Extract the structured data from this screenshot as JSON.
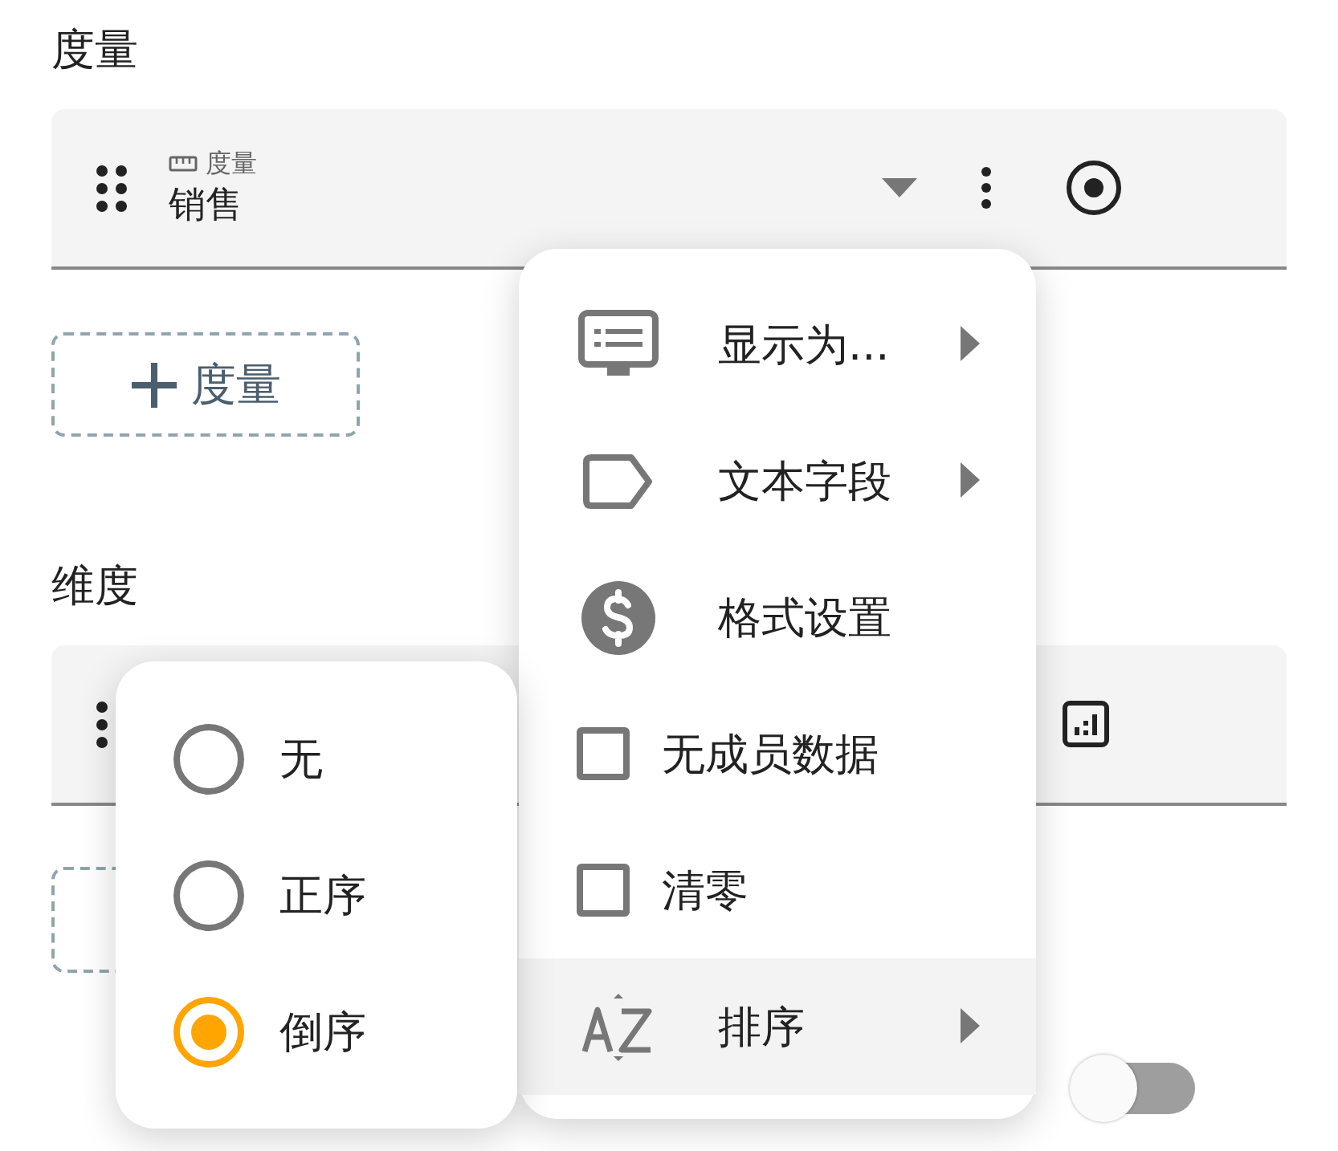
{
  "measures": {
    "heading": "度量",
    "items": [
      {
        "label": "度量",
        "value": "销售"
      }
    ],
    "add_button": "度量"
  },
  "dimensions": {
    "heading": "维度"
  },
  "toggle": {
    "on": false
  },
  "context_menu": {
    "items": [
      {
        "kind": "submenu",
        "label": "显示为...",
        "selected": false
      },
      {
        "kind": "submenu",
        "label": "文本字段",
        "selected": false
      },
      {
        "kind": "action",
        "label": "格式设置",
        "selected": false
      },
      {
        "kind": "checkbox",
        "label": "无成员数据",
        "checked": false,
        "selected": false
      },
      {
        "kind": "checkbox",
        "label": "清零",
        "checked": false,
        "selected": false
      },
      {
        "kind": "submenu",
        "label": "排序",
        "selected": true
      }
    ]
  },
  "sort_menu": {
    "options": [
      {
        "label": "无",
        "selected": false
      },
      {
        "label": "正序",
        "selected": false
      },
      {
        "label": "倒序",
        "selected": true
      }
    ]
  }
}
